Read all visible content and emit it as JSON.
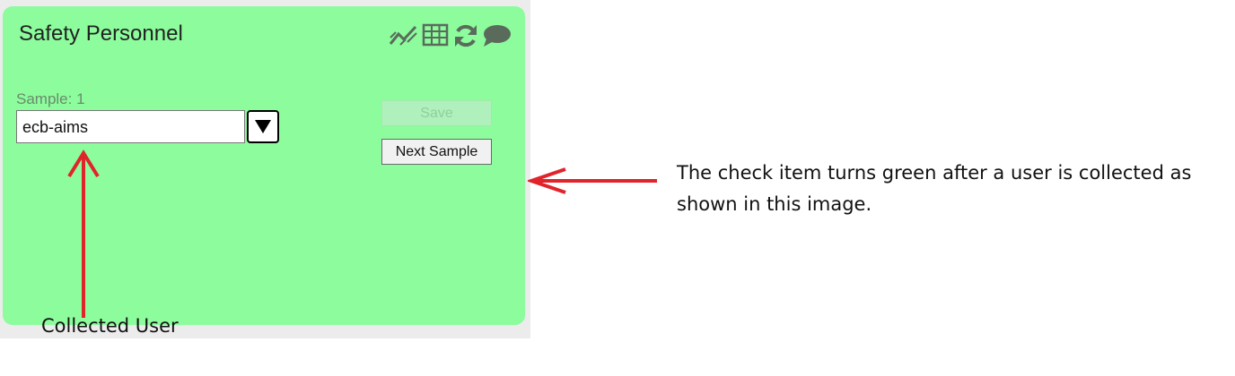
{
  "card": {
    "title": "Safety Personnel",
    "background_color": "#8cfc9c",
    "toolbar_icons": [
      "trend-chart-icon",
      "table-grid-icon",
      "refresh-icon",
      "comment-icon"
    ]
  },
  "sample": {
    "label": "Sample: 1",
    "user_value": "ecb-aims"
  },
  "buttons": {
    "save_label": "Save",
    "next_label": "Next Sample"
  },
  "annotations": {
    "right_note": "The check item turns green after a user is collected as shown in this image.",
    "bottom_note": "Collected User",
    "arrow_color": "#e0242b"
  }
}
